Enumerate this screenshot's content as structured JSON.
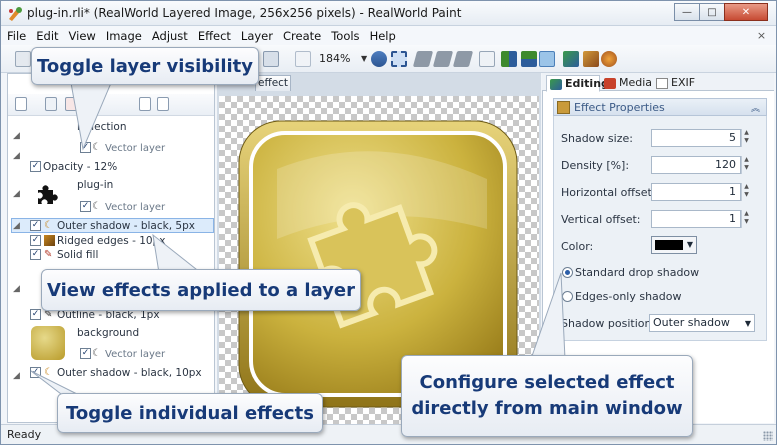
{
  "window": {
    "title": "plug-in.rli* (RealWorld Layered Image, 256x256 pixels) - RealWorld Paint",
    "caption_minimize": "—",
    "caption_maximize": "□",
    "caption_close": "✕",
    "doc_close": "×"
  },
  "menu": [
    "File",
    "Edit",
    "View",
    "Image",
    "Adjust",
    "Effect",
    "Layer",
    "Create",
    "Tools",
    "Help"
  ],
  "toolbar": {
    "zoom": "184%",
    "zoom_caret": "▼"
  },
  "layers_panel": {
    "layers": [
      {
        "name": "reflection",
        "type": "Vector layer"
      },
      {
        "name": "plug-in",
        "type": "Vector layer"
      },
      {
        "name": "background",
        "type": "Vector layer"
      }
    ],
    "effect_rows": {
      "opacity": "Opacity - 12%",
      "outer_shadow_1": "Outer shadow - black, 5px",
      "ridged_edges": "Ridged edges - 10px",
      "solid_fill": "Solid fill",
      "outline": "Outline - black, 1px",
      "outer_shadow_2": "Outer shadow - black, 10px"
    },
    "check_mark": "✓",
    "expander": "◢"
  },
  "canvas": {
    "doc_tab": "effect"
  },
  "right_panel": {
    "tabs": [
      "Editing",
      "Media",
      "EXIF"
    ],
    "effect_header": "Effect Properties",
    "collapse_glyph": "︽",
    "properties": {
      "shadow_size": {
        "label": "Shadow size:",
        "value": "5"
      },
      "density": {
        "label": "Density [%]:",
        "value": "120"
      },
      "h_offset": {
        "label": "Horizontal offset:",
        "value": "1"
      },
      "v_offset": {
        "label": "Vertical offset:",
        "value": "1"
      }
    },
    "color_label": "Color:",
    "color_value": "#000000",
    "radio_standard": "Standard drop shadow",
    "radio_edges": "Edges-only shadow",
    "shadow_position_label": "Shadow position:",
    "shadow_position_value": "Outer shadow",
    "spin_up": "▲",
    "spin_down": "▼",
    "caret": "▼"
  },
  "status": {
    "text": "Ready"
  },
  "callouts": {
    "visibility": "Toggle layer visibility",
    "effects_applied": "View effects applied to a layer",
    "individual": "Toggle individual effects",
    "configure_line1": "Configure selected effect",
    "configure_line2": "directly from main window"
  },
  "colors": {
    "callout_text": "#173a78",
    "gold": "#c9ad3a",
    "selection": "#dcebfb"
  }
}
